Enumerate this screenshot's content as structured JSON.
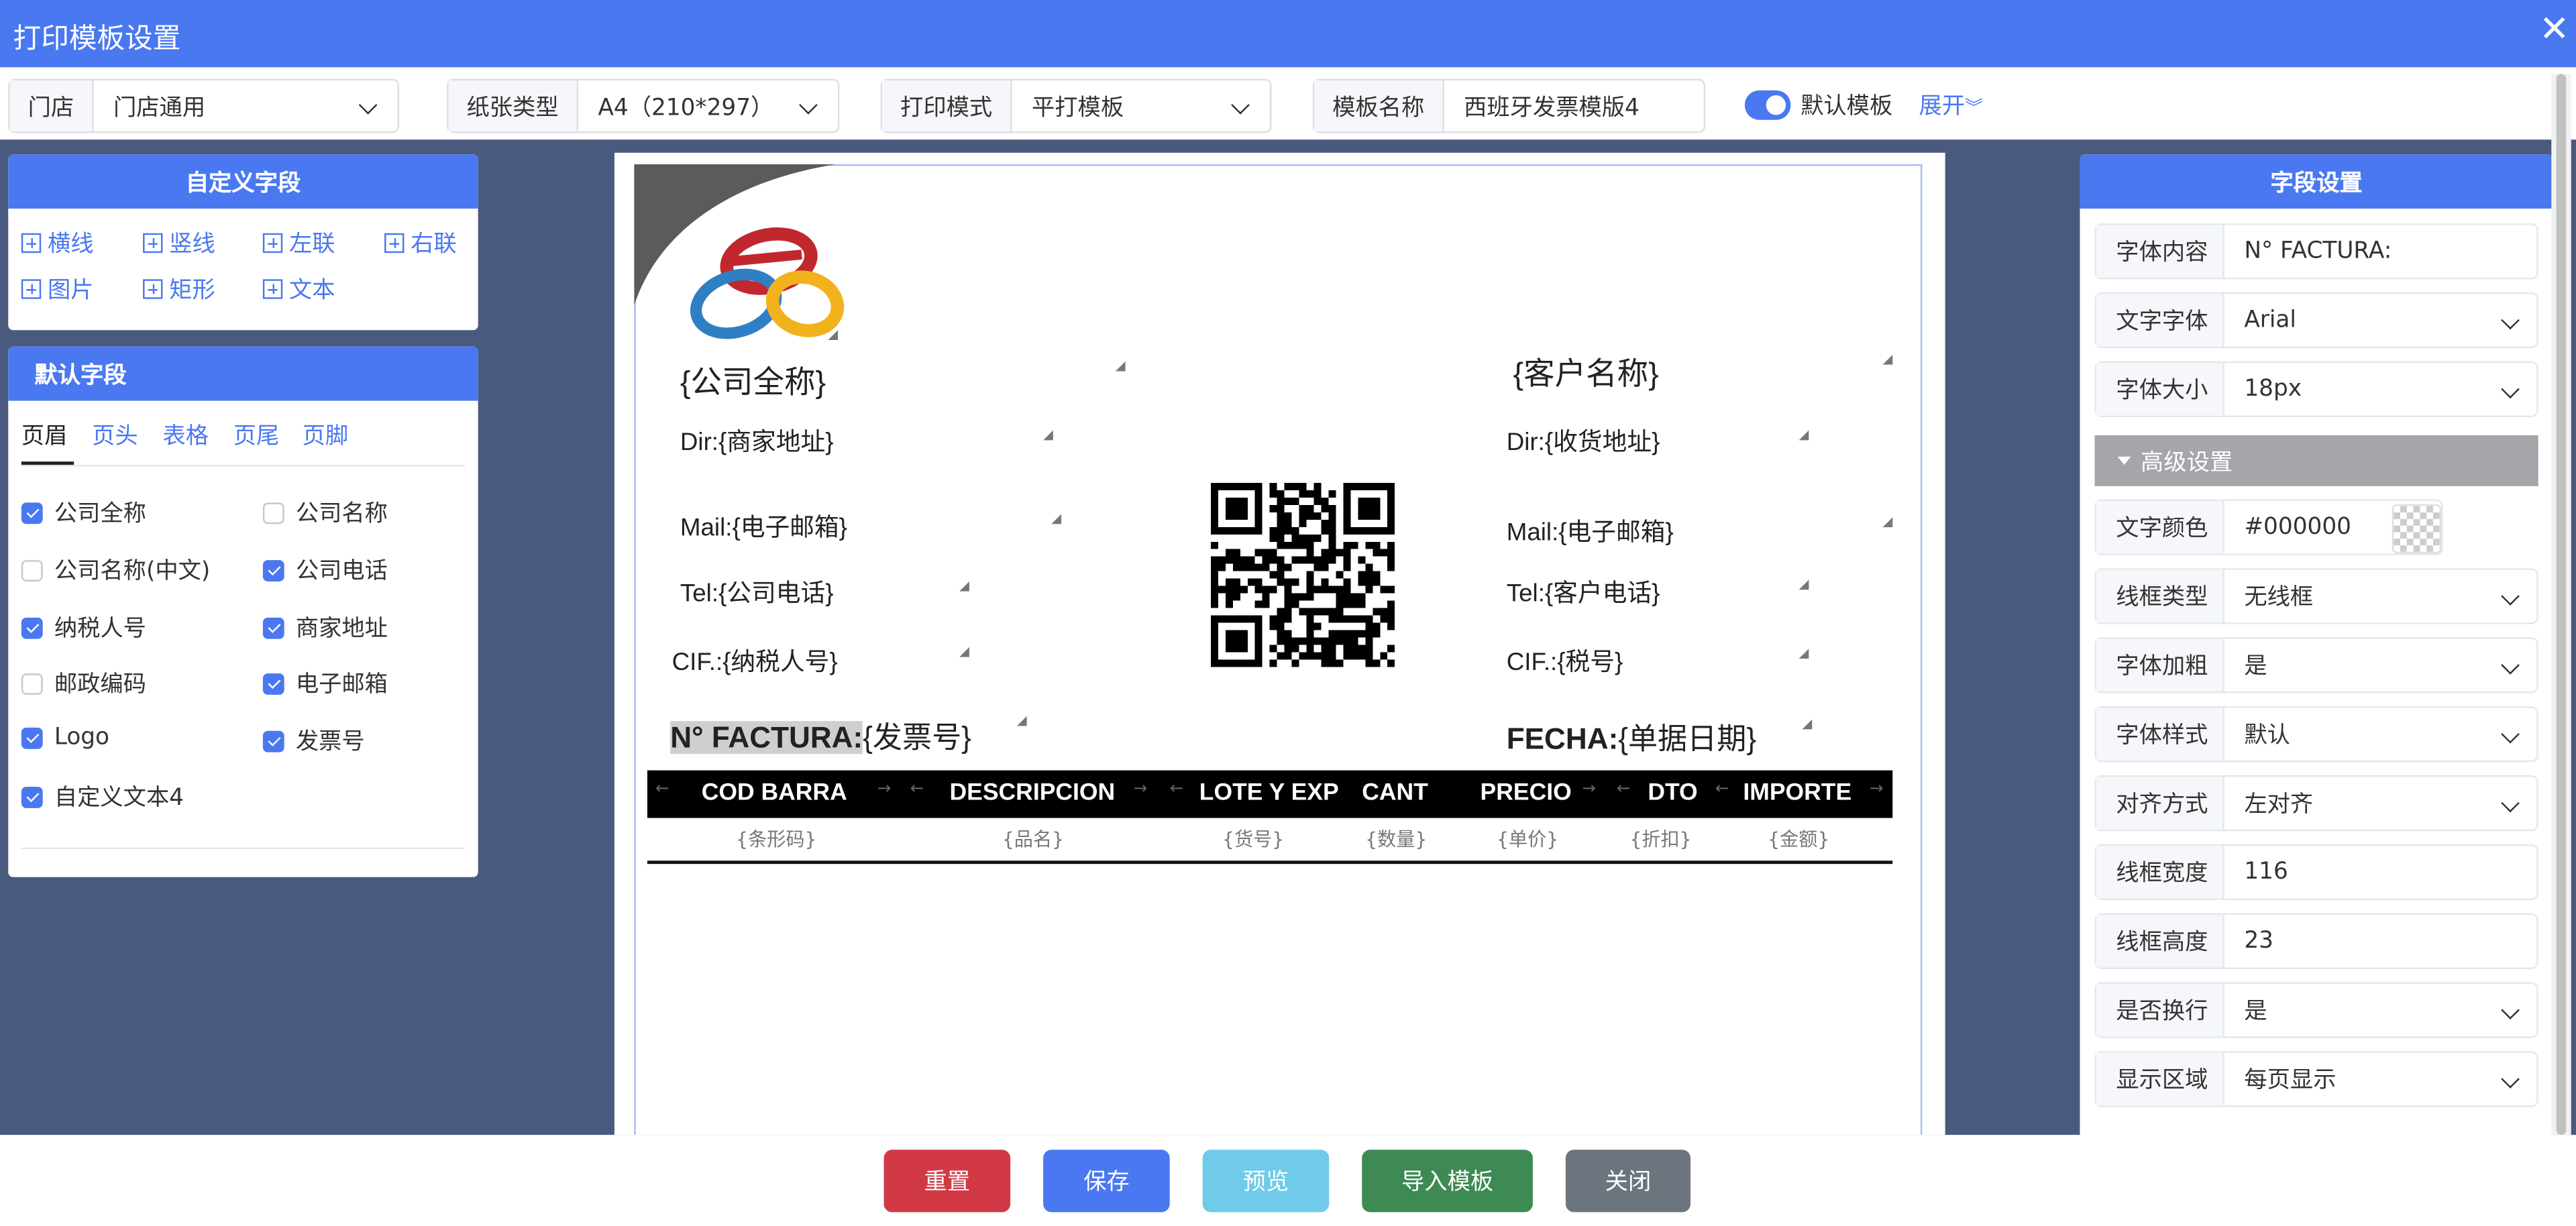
{
  "window": {
    "title": "打印模板设置",
    "close_glyph": "✕"
  },
  "toolbar": {
    "store": {
      "label": "门店",
      "value": "门店通用"
    },
    "paper": {
      "label": "纸张类型",
      "value": "A4（210*297）"
    },
    "mode": {
      "label": "打印模式",
      "value": "平打模板"
    },
    "name": {
      "label": "模板名称",
      "value": "西班牙发票模版4"
    },
    "default_toggle": {
      "label": "默认模板",
      "on": true
    },
    "expand_label": "展开"
  },
  "custom_fields": {
    "title": "自定义字段",
    "items": [
      "横线",
      "竖线",
      "左联",
      "右联",
      "图片",
      "矩形",
      "文本"
    ]
  },
  "default_fields": {
    "title": "默认字段",
    "tabs": [
      "页眉",
      "页头",
      "表格",
      "页尾",
      "页脚"
    ],
    "active_tab": "页眉",
    "items": [
      {
        "label": "公司全称",
        "checked": true
      },
      {
        "label": "公司名称",
        "checked": false
      },
      {
        "label": "公司名称(中文)",
        "checked": false
      },
      {
        "label": "公司电话",
        "checked": true
      },
      {
        "label": "纳税人号",
        "checked": true
      },
      {
        "label": "商家地址",
        "checked": true
      },
      {
        "label": "邮政编码",
        "checked": false
      },
      {
        "label": "电子邮箱",
        "checked": true
      },
      {
        "label": "Logo",
        "checked": true
      },
      {
        "label": "发票号",
        "checked": true
      },
      {
        "label": "自定义文本4",
        "checked": true
      }
    ]
  },
  "template": {
    "company_full_name": "{公司全称}",
    "address": "Dir:{商家地址}",
    "email": "Mail:{电子邮箱}",
    "phone": "Tel:{公司电话}",
    "cif": "CIF.:{纳税人号}",
    "invoice_label": "N° FACTURA:",
    "invoice_value": "{发票号}",
    "customer_name": "{客户名称}",
    "delivery_address": "Dir:{收货地址}",
    "customer_mail": "Mail:{电子邮箱}",
    "customer_phone": "Tel:{客户电话}",
    "customer_cif": "CIF.:{税号}",
    "date_label": "FECHA:",
    "date_value": "{单据日期}",
    "logo_colors": {
      "red": "#c0282e",
      "blue": "#2f7fc4",
      "yellow": "#f2b21e"
    },
    "table": {
      "headers": [
        "COD BARRA",
        "DESCRIPCION",
        "LOTE Y EXP",
        "CANT",
        "PRECIO",
        "DTO",
        "IMPORTE"
      ],
      "placeholders": [
        "{条形码}",
        "{品名}",
        "{货号}",
        "{数量}",
        "{单价}",
        "{折扣}",
        "{金额}"
      ]
    }
  },
  "field_settings": {
    "title": "字段设置",
    "font_content": {
      "label": "字体内容",
      "value": "N° FACTURA:"
    },
    "font_family": {
      "label": "文字字体",
      "value": "Arial"
    },
    "font_size": {
      "label": "字体大小",
      "value": "18px"
    },
    "advanced": "高级设置",
    "color": {
      "label": "文字颜色",
      "value": "#000000"
    },
    "border_type": {
      "label": "线框类型",
      "value": "无线框"
    },
    "bold": {
      "label": "字体加粗",
      "value": "是"
    },
    "style": {
      "label": "字体样式",
      "value": "默认"
    },
    "align": {
      "label": "对齐方式",
      "value": "左对齐"
    },
    "box_width": {
      "label": "线框宽度",
      "value": "116"
    },
    "box_height": {
      "label": "线框高度",
      "value": "23"
    },
    "wrap": {
      "label": "是否换行",
      "value": "是"
    },
    "display": {
      "label": "显示区域",
      "value": "每页显示"
    }
  },
  "buttons": {
    "reset": "重置",
    "save": "保存",
    "preview": "预览",
    "import": "导入模板",
    "close": "关闭"
  },
  "colors": {
    "primary": "#4a78f0",
    "reset": "#d13a45",
    "preview": "#6fcbe9",
    "import": "#3e8a55",
    "close": "#6c757d",
    "canvas": "#4a5a7e"
  }
}
